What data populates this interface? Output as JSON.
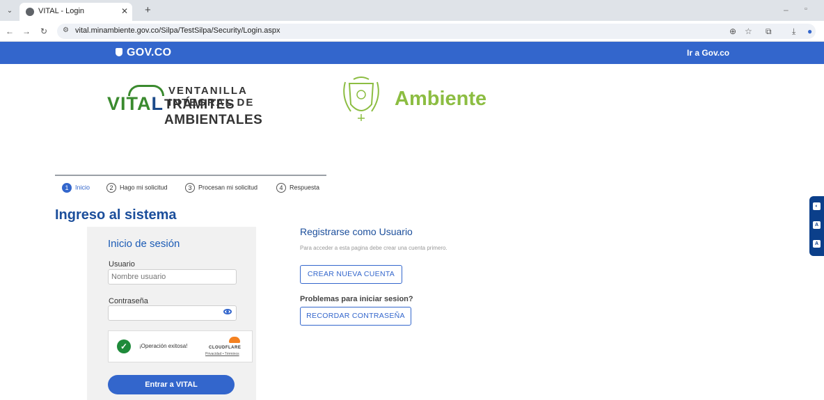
{
  "browser": {
    "tab_title": "VITAL - Login",
    "url": "vital.minambiente.gov.co/Silpa/TestSilpa/Security/Login.aspx"
  },
  "govbar": {
    "logo": "GOV.CO",
    "link": "Ir a Gov.co",
    "color": "#3366cc"
  },
  "branding": {
    "vital_word_a": "VITA",
    "vital_word_b": "L",
    "vital_tag1": "VENTANILLA INTEGRAL DE",
    "vital_tag2": "TRÁMITES AMBIENTALES",
    "ambiente": "Ambiente"
  },
  "steps": [
    {
      "num": "1",
      "label": "Inicio",
      "active": true
    },
    {
      "num": "2",
      "label": "Hago mi solicitud",
      "active": false
    },
    {
      "num": "3",
      "label": "Procesan mi solicitud",
      "active": false
    },
    {
      "num": "4",
      "label": "Respuesta",
      "active": false
    }
  ],
  "page_title": "Ingreso al sistema",
  "login": {
    "title": "Inicio de sesión",
    "user_label": "Usuario",
    "user_placeholder": "Nombre usuario",
    "password_label": "Contraseña",
    "captcha_text": "¡Operación exitosa!",
    "cloudflare": "CLOUDFLARE",
    "cloudflare_links": "Privacidad • Términos",
    "submit": "Entrar a VITAL"
  },
  "register": {
    "title": "Registrarse como Usuario",
    "desc": "Para acceder a esta pagina debe crear una cuenta primero.",
    "create_button": "CREAR NUEVA CUENTA",
    "problems": "Problemas para iniciar sesion?",
    "remember_button": "RECORDAR CONTRASEÑA"
  }
}
